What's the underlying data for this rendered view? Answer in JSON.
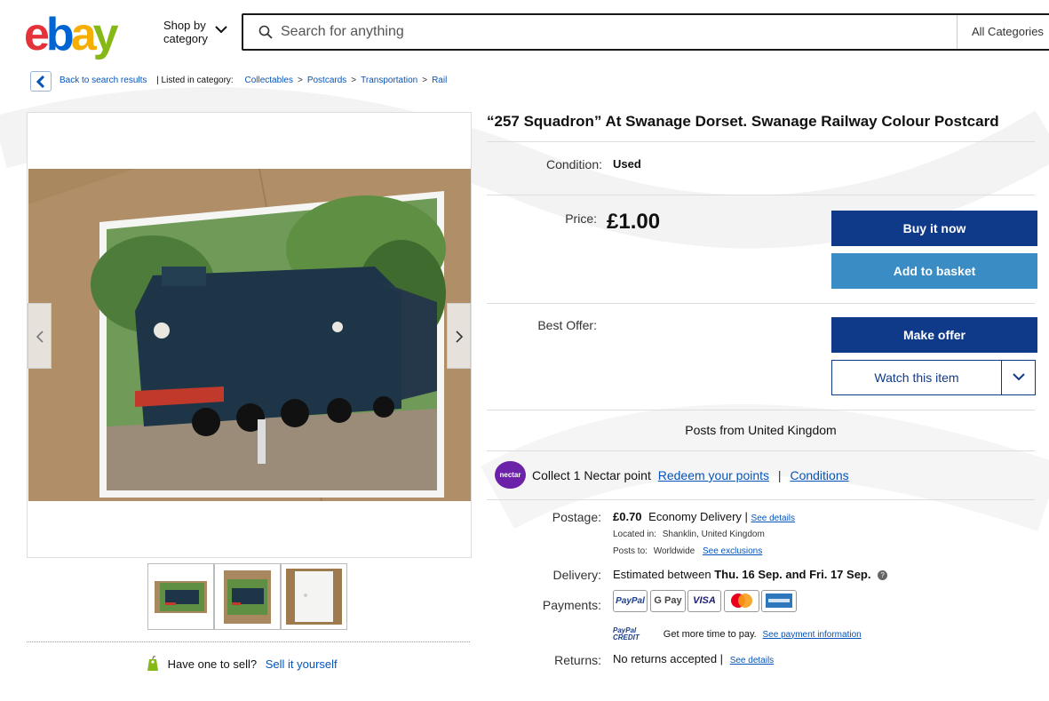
{
  "header": {
    "logo": {
      "e": "e",
      "b": "b",
      "a": "a",
      "y": "y"
    },
    "shop_by_line1": "Shop by",
    "shop_by_line2": "category",
    "search_placeholder": "Search for anything",
    "all_categories": "All Categories"
  },
  "breadcrumb": {
    "back_label": "Back to search results",
    "listed_in": "| Listed in category:",
    "items": [
      "Collectables",
      "Postcards",
      "Transportation",
      "Rail"
    ],
    "separator": ">"
  },
  "gallery": {
    "thumbnails": [
      "thumb-1",
      "thumb-2",
      "thumb-3"
    ]
  },
  "sell": {
    "question": "Have one to sell?",
    "link": "Sell it yourself"
  },
  "item": {
    "title": "“257 Squadron” At Swanage Dorset. Swanage Railway Colour Postcard",
    "condition_label": "Condition:",
    "condition_value": "Used",
    "price_label": "Price:",
    "price_value": "£1.00",
    "best_offer_label": "Best Offer:",
    "posts_from": "Posts from United Kingdom"
  },
  "buttons": {
    "buy_now": "Buy it now",
    "add_basket": "Add to basket",
    "make_offer": "Make offer",
    "watch": "Watch this item"
  },
  "nectar": {
    "badge": "nectar",
    "text": "Collect 1 Nectar point",
    "redeem": "Redeem your points",
    "bar": "|",
    "conditions": "Conditions"
  },
  "postage": {
    "label": "Postage:",
    "price": "£0.70",
    "method": "Economy Delivery |",
    "see_details": "See details",
    "located_label": "Located in:",
    "located_value": "Shanklin, United Kingdom",
    "posts_to_label": "Posts to:",
    "posts_to_value": "Worldwide",
    "see_exclusions": "See exclusions"
  },
  "delivery": {
    "label": "Delivery:",
    "prefix": "Estimated between",
    "dates": "Thu. 16 Sep. and Fri. 17 Sep.",
    "help": "?"
  },
  "payments": {
    "label": "Payments:",
    "methods": [
      "PayPal",
      "G Pay",
      "VISA",
      "mastercard",
      "AMERICAN EXPRESS"
    ],
    "credit_badge": "PayPal CREDIT",
    "credit_text": "Get more time to pay.",
    "credit_link": "See payment information"
  },
  "returns": {
    "label": "Returns:",
    "value": "No returns accepted |",
    "see_details": "See details"
  },
  "colors": {
    "ebay_red": "#e53238",
    "ebay_blue": "#0064d2",
    "ebay_yellow": "#f5af02",
    "ebay_green": "#86b817",
    "primary_button": "#0f3a8a",
    "secondary_button": "#3a8cc5",
    "link": "#0654ba"
  }
}
